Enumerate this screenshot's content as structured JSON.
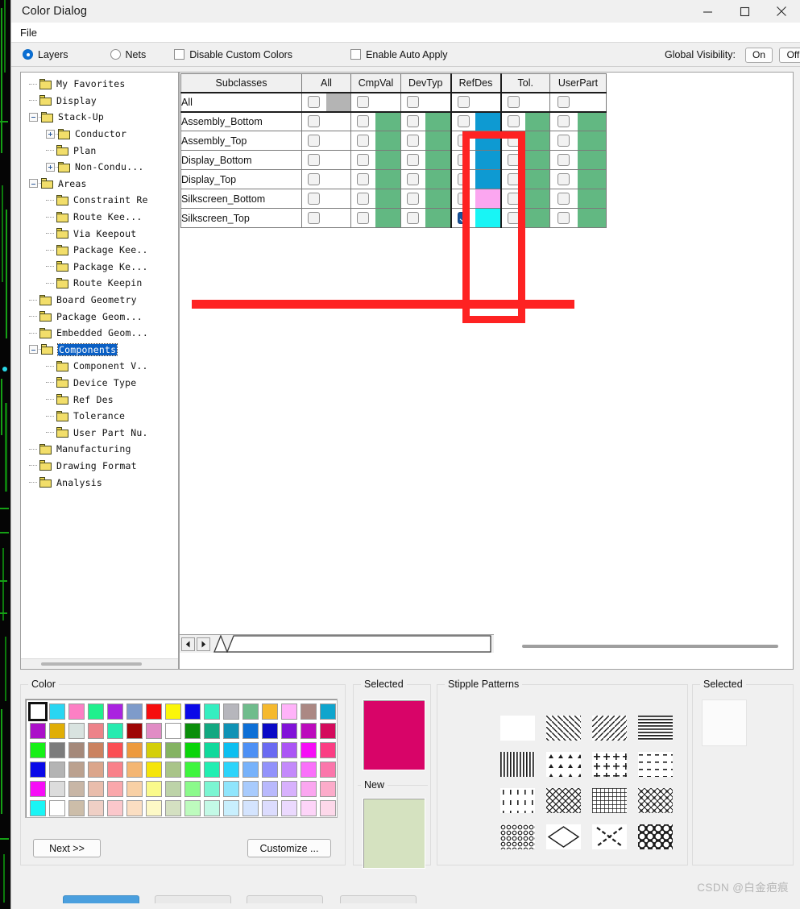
{
  "window": {
    "title": "Color Dialog",
    "controls": {
      "minimize": "minimize-icon",
      "maximize": "maximize-icon",
      "close": "close-icon"
    }
  },
  "menubar": {
    "items": [
      "File"
    ]
  },
  "options": {
    "layers": {
      "label": "Layers",
      "selected": true
    },
    "nets": {
      "label": "Nets",
      "selected": false
    },
    "disable_custom_colors": {
      "label": "Disable Custom Colors",
      "checked": false
    },
    "enable_auto_apply": {
      "label": "Enable Auto Apply",
      "checked": false
    },
    "global_visibility": {
      "label": "Global Visibility:",
      "on": "On",
      "off": "Off"
    }
  },
  "tree": {
    "nodes": [
      {
        "label": "My Favorites",
        "depth": 1,
        "expander": "none",
        "open": false
      },
      {
        "label": "Display",
        "depth": 1,
        "expander": "none",
        "open": false
      },
      {
        "label": "Stack-Up",
        "depth": 1,
        "expander": "minus",
        "open": true
      },
      {
        "label": "Conductor",
        "depth": 2,
        "expander": "plus",
        "open": false
      },
      {
        "label": "Plan",
        "depth": 2,
        "expander": "none",
        "open": false
      },
      {
        "label": "Non-Condu...",
        "depth": 2,
        "expander": "plus",
        "open": false
      },
      {
        "label": "Areas",
        "depth": 1,
        "expander": "minus",
        "open": true
      },
      {
        "label": "Constraint Re",
        "depth": 2,
        "expander": "none",
        "open": false
      },
      {
        "label": "Route Kee...",
        "depth": 2,
        "expander": "none",
        "open": false
      },
      {
        "label": "Via Keepout",
        "depth": 2,
        "expander": "none",
        "open": false
      },
      {
        "label": "Package Kee..",
        "depth": 2,
        "expander": "none",
        "open": false
      },
      {
        "label": "Package Ke...",
        "depth": 2,
        "expander": "none",
        "open": false
      },
      {
        "label": "Route Keepin",
        "depth": 2,
        "expander": "none",
        "open": false
      },
      {
        "label": "Board Geometry",
        "depth": 1,
        "expander": "none",
        "open": false
      },
      {
        "label": "Package Geom...",
        "depth": 1,
        "expander": "none",
        "open": false
      },
      {
        "label": "Embedded Geom...",
        "depth": 1,
        "expander": "none",
        "open": false
      },
      {
        "label": "Components",
        "depth": 1,
        "expander": "minus",
        "open": true,
        "selected": true
      },
      {
        "label": "Component V..",
        "depth": 2,
        "expander": "none",
        "open": false
      },
      {
        "label": "Device Type",
        "depth": 2,
        "expander": "none",
        "open": false
      },
      {
        "label": "Ref Des",
        "depth": 2,
        "expander": "none",
        "open": false
      },
      {
        "label": "Tolerance",
        "depth": 2,
        "expander": "none",
        "open": false
      },
      {
        "label": "User Part Nu.",
        "depth": 2,
        "expander": "none",
        "open": false
      },
      {
        "label": "Manufacturing",
        "depth": 1,
        "expander": "none",
        "open": false
      },
      {
        "label": "Drawing Format",
        "depth": 1,
        "expander": "none",
        "open": false
      },
      {
        "label": "Analysis",
        "depth": 1,
        "expander": "none",
        "open": false
      }
    ]
  },
  "grid": {
    "columns": [
      "Subclasses",
      "All",
      "CmpVal",
      "DevTyp",
      "RefDes",
      "Tol.",
      "UserPart"
    ],
    "rows": [
      {
        "name": "All",
        "cells": [
          {
            "checked": false,
            "color": "#b4b4b4"
          },
          {
            "checked": false,
            "color": "#ffffff"
          },
          {
            "checked": false,
            "color": "#ffffff"
          },
          {
            "checked": false,
            "color": "#ffffff"
          },
          {
            "checked": false,
            "color": "#ffffff"
          },
          {
            "checked": false,
            "color": "#ffffff"
          }
        ]
      },
      {
        "name": "Assembly_Bottom",
        "cells": [
          {
            "checked": false,
            "color": "#ffffff"
          },
          {
            "checked": false,
            "color": "#62b882"
          },
          {
            "checked": false,
            "color": "#62b882"
          },
          {
            "checked": false,
            "color": "#0e9ad2"
          },
          {
            "checked": false,
            "color": "#62b882"
          },
          {
            "checked": false,
            "color": "#62b882"
          }
        ]
      },
      {
        "name": "Assembly_Top",
        "cells": [
          {
            "checked": false,
            "color": "#ffffff"
          },
          {
            "checked": false,
            "color": "#62b882"
          },
          {
            "checked": false,
            "color": "#62b882"
          },
          {
            "checked": false,
            "color": "#0e9ad2"
          },
          {
            "checked": false,
            "color": "#62b882"
          },
          {
            "checked": false,
            "color": "#62b882"
          }
        ]
      },
      {
        "name": "Display_Bottom",
        "cells": [
          {
            "checked": false,
            "color": "#ffffff"
          },
          {
            "checked": false,
            "color": "#62b882"
          },
          {
            "checked": false,
            "color": "#62b882"
          },
          {
            "checked": false,
            "color": "#0e9ad2"
          },
          {
            "checked": false,
            "color": "#62b882"
          },
          {
            "checked": false,
            "color": "#62b882"
          }
        ]
      },
      {
        "name": "Display_Top",
        "cells": [
          {
            "checked": false,
            "color": "#ffffff"
          },
          {
            "checked": false,
            "color": "#62b882"
          },
          {
            "checked": false,
            "color": "#62b882"
          },
          {
            "checked": false,
            "color": "#0e9ad2"
          },
          {
            "checked": false,
            "color": "#62b882"
          },
          {
            "checked": false,
            "color": "#62b882"
          }
        ]
      },
      {
        "name": "Silkscreen_Bottom",
        "cells": [
          {
            "checked": false,
            "color": "#ffffff"
          },
          {
            "checked": false,
            "color": "#62b882"
          },
          {
            "checked": false,
            "color": "#62b882"
          },
          {
            "checked": false,
            "color": "#fba6f0"
          },
          {
            "checked": false,
            "color": "#62b882"
          },
          {
            "checked": false,
            "color": "#62b882"
          }
        ]
      },
      {
        "name": "Silkscreen_Top",
        "cells": [
          {
            "checked": false,
            "color": "#ffffff"
          },
          {
            "checked": false,
            "color": "#62b882"
          },
          {
            "checked": false,
            "color": "#62b882"
          },
          {
            "checked": true,
            "color": "#18f5f5"
          },
          {
            "checked": false,
            "color": "#62b882"
          },
          {
            "checked": false,
            "color": "#62b882"
          }
        ]
      }
    ]
  },
  "color_panel": {
    "legend": "Color",
    "next_label": "Next >>",
    "customize_label": "Customize ...",
    "selected_index": 0,
    "swatches": [
      "#ffffff",
      "#29d6f2",
      "#fc7fc4",
      "#20f08d",
      "#aa23e0",
      "#7e9bca",
      "#f60d0d",
      "#fbf60a",
      "#0a09e8",
      "#35eec0",
      "#b6b6bc",
      "#6fbc8c",
      "#f5b92e",
      "#ffb3f9",
      "#ab8883",
      "#0fa5cd",
      "#ab0fc9",
      "#e0ae06",
      "#d9e3e0",
      "#ed8289",
      "#27ebb0",
      "#9e0606",
      "#e18cc5",
      "#ffffff",
      "#0a8e0a",
      "#12a881",
      "#0f92b5",
      "#0d6fd6",
      "#0a09c6",
      "#8112d8",
      "#bc0bbc",
      "#d40a5c",
      "#16f016",
      "#7c7c7c",
      "#a5897a",
      "#cb8260",
      "#fb4f54",
      "#ed9a3e",
      "#d4cf09",
      "#84b362",
      "#0ad40a",
      "#10d99c",
      "#0cbff0",
      "#4d90f5",
      "#6a6af2",
      "#ab55f5",
      "#f60df6",
      "#fb3d83",
      "#0a09e8",
      "#b4b4b4",
      "#bba18f",
      "#dba58b",
      "#f9818a",
      "#f4b673",
      "#f5e50a",
      "#a9c489",
      "#3ef53e",
      "#22eeb2",
      "#2cd4fa",
      "#77b2fb",
      "#9292fb",
      "#c48afb",
      "#fa70fa",
      "#fb76ab",
      "#f70df7",
      "#dcdcdc",
      "#c8b6a6",
      "#e9bdac",
      "#faa7ab",
      "#f8d0a5",
      "#fafa8b",
      "#bdd3a8",
      "#8bfa8b",
      "#7bf5d2",
      "#8fe5fc",
      "#a8cbfd",
      "#b9b9fd",
      "#d8b1fd",
      "#fba6f0",
      "#fcabca",
      "#1af5f5",
      "#ffffff",
      "#ccbda9",
      "#efcfc5",
      "#fbc7cb",
      "#fbdec2",
      "#fdf9c6",
      "#d4e0c1",
      "#bdfbbd",
      "#c3f9e6",
      "#c8effd",
      "#d4e4fe",
      "#dcdcfe",
      "#ebd9fe",
      "#fdd4f8",
      "#fdd8ea"
    ]
  },
  "selected_panel": {
    "selected_legend": "Selected",
    "selected_color": "#d80468",
    "new_legend": "New",
    "new_color": "#d5e2c0"
  },
  "stipple_panel": {
    "legend": "Stipple Patterns",
    "patterns": [
      "solid-blank",
      "diagonal-back-slash",
      "diagonal-forward-slash",
      "horizontal-lines",
      "vertical-lines",
      "triangles",
      "plus-marks",
      "dashes",
      "short-verticals",
      "cross-hatch-diamond",
      "dense-grid",
      "dotted-diamond",
      "small-circles",
      "large-diamond-outline",
      "bold-x-cross",
      "bold-checker-diamond"
    ]
  },
  "stipple_selected_panel": {
    "legend": "Selected",
    "color": "#fbfbfb"
  },
  "watermark": {
    "text": "CSDN @白金疤痕"
  }
}
